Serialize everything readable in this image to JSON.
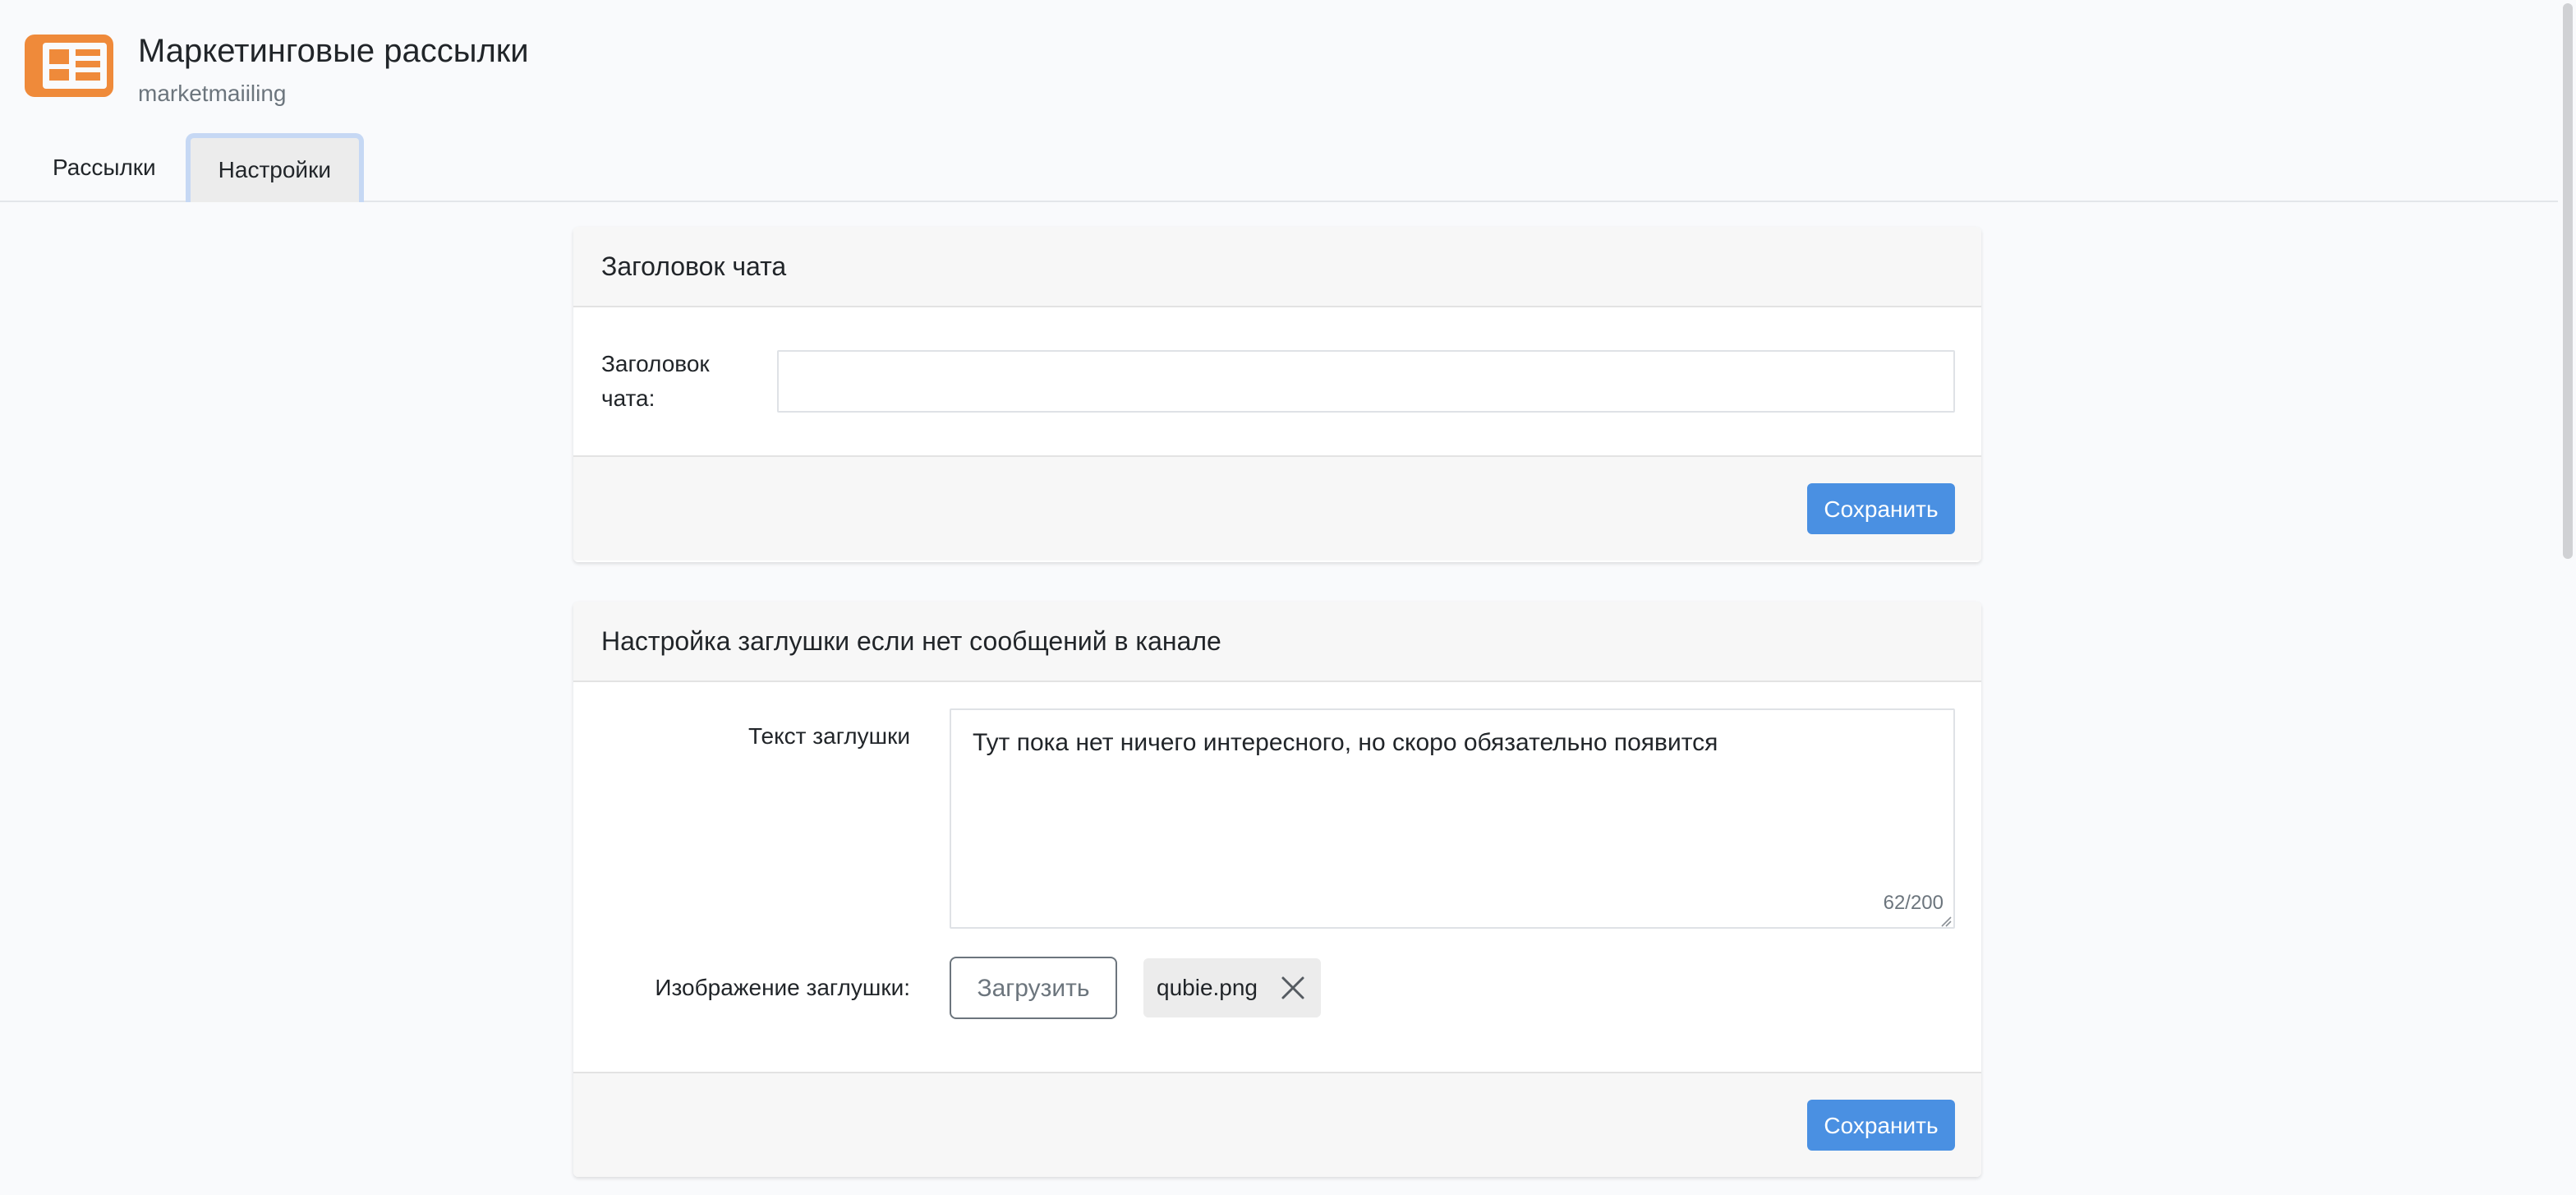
{
  "header": {
    "title": "Маркетинговые рассылки",
    "subtitle": "marketmaiiling",
    "logo_icon": "newspaper-icon",
    "accent_color": "#ef8a3a"
  },
  "tabs": [
    {
      "label": "Рассылки",
      "active": false
    },
    {
      "label": "Настройки",
      "active": true
    }
  ],
  "chat_title_card": {
    "heading": "Заголовок чата",
    "field_label": "Заголовок чата:",
    "value": "",
    "save_label": "Сохранить"
  },
  "placeholder_card": {
    "heading": "Настройка заглушки если нет сообщений в канале",
    "text_label": "Текст заглушки",
    "text_value": "Тут пока нет ничего интересного, но скоро обязательно появится",
    "counter": "62/200",
    "image_label": "Изображение заглушки:",
    "upload_label": "Загрузить",
    "file_name": "qubie.png",
    "remove_icon": "close-icon",
    "save_label": "Сохранить"
  },
  "colors": {
    "primary_button": "#4a90e2",
    "active_tab_border": "#c6d8f4"
  }
}
